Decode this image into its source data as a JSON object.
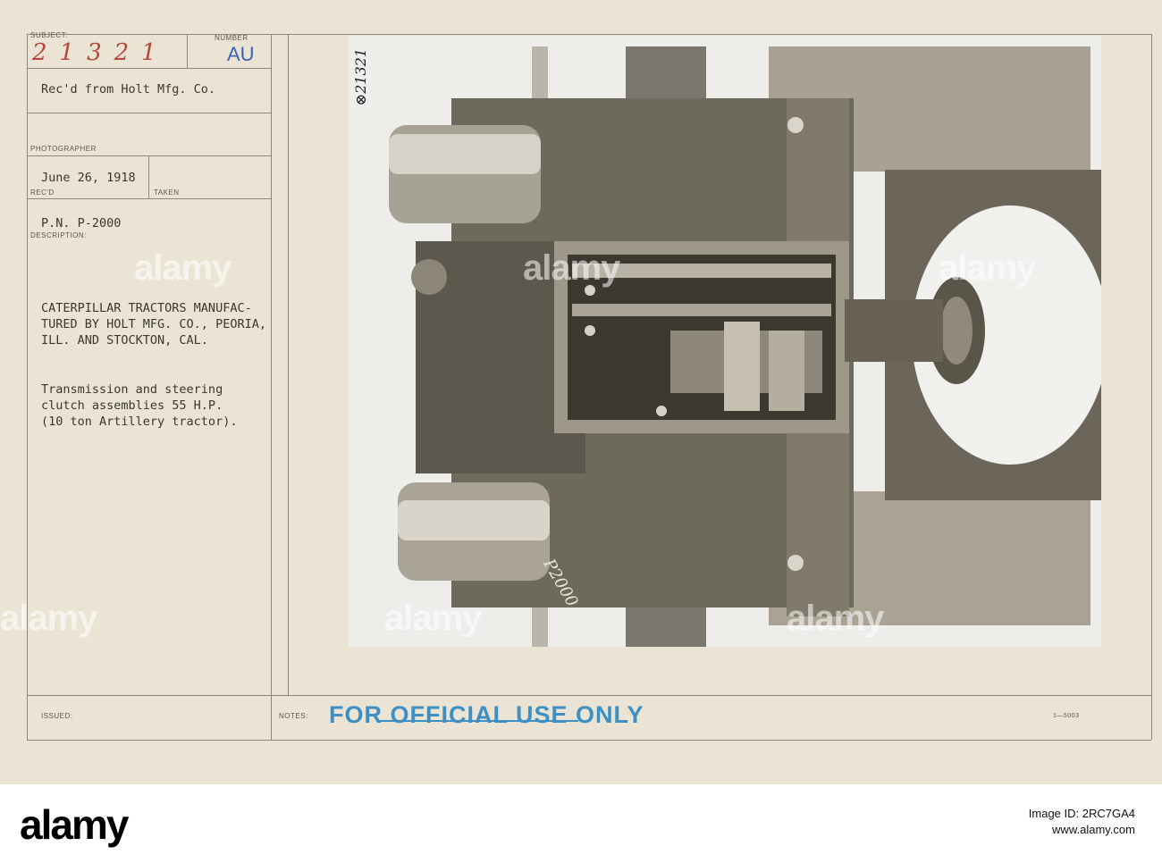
{
  "card": {
    "subject_label": "SUBJECT:",
    "subject_value": "21321",
    "number_label": "NUMBER",
    "number_value": "AU",
    "source": "Rec'd from Holt Mfg. Co.",
    "photographer_label": "PHOTOGRAPHER",
    "date": "June 26, 1918",
    "recd_label": "REC'D",
    "taken_label": "TAKEN",
    "pn": "P.N. P-2000",
    "description_label": "DESCRIPTION:",
    "description_lines": [
      "CATERPILLAR TRACTORS MANUFAC-",
      "TURED BY HOLT MFG. CO., PEORIA,",
      "ILL. AND STOCKTON, CAL."
    ],
    "caption_lines": [
      "Transmission and steering",
      "clutch assemblies 55 H.P.",
      "(10 ton Artillery tractor)."
    ],
    "issued_label": "ISSUED:",
    "notes_label": "NOTES:",
    "stamp": "FOR OFFICIAL USE ONLY",
    "form_number": "1—5003"
  },
  "photo": {
    "corner_number": "⊗21321",
    "plate_number": "P2000",
    "subject": "transmission and steering clutch assembly"
  },
  "watermark": {
    "text": "alamy"
  },
  "footer": {
    "brand": "alamy",
    "image_id_label": "Image ID: 2RC7GA4",
    "site": "www.alamy.com"
  }
}
